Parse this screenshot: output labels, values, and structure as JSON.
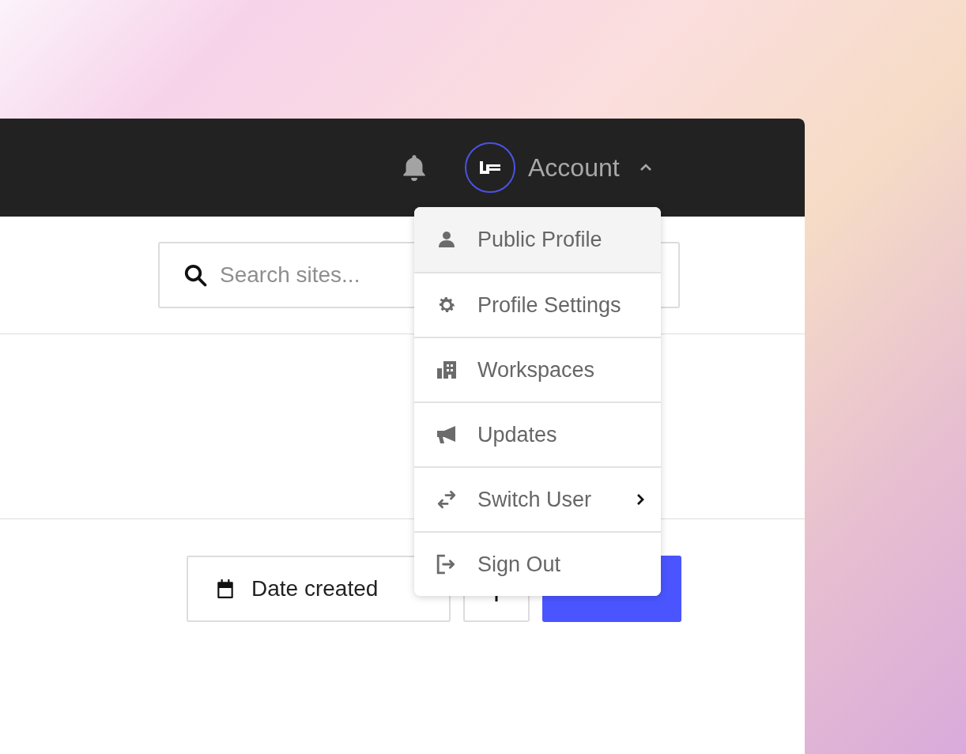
{
  "header": {
    "account_label": "Account",
    "menu_open": true
  },
  "search": {
    "placeholder": "Search sites..."
  },
  "toolbar": {
    "sort_label": "Date created"
  },
  "account_menu": [
    {
      "label": "Public Profile",
      "selected": true,
      "submenu": false
    },
    {
      "label": "Profile Settings",
      "selected": false,
      "submenu": false
    },
    {
      "label": "Workspaces",
      "selected": false,
      "submenu": false
    },
    {
      "label": "Updates",
      "selected": false,
      "submenu": false
    },
    {
      "label": "Switch User",
      "selected": false,
      "submenu": true
    },
    {
      "label": "Sign Out",
      "selected": false,
      "submenu": false
    }
  ]
}
